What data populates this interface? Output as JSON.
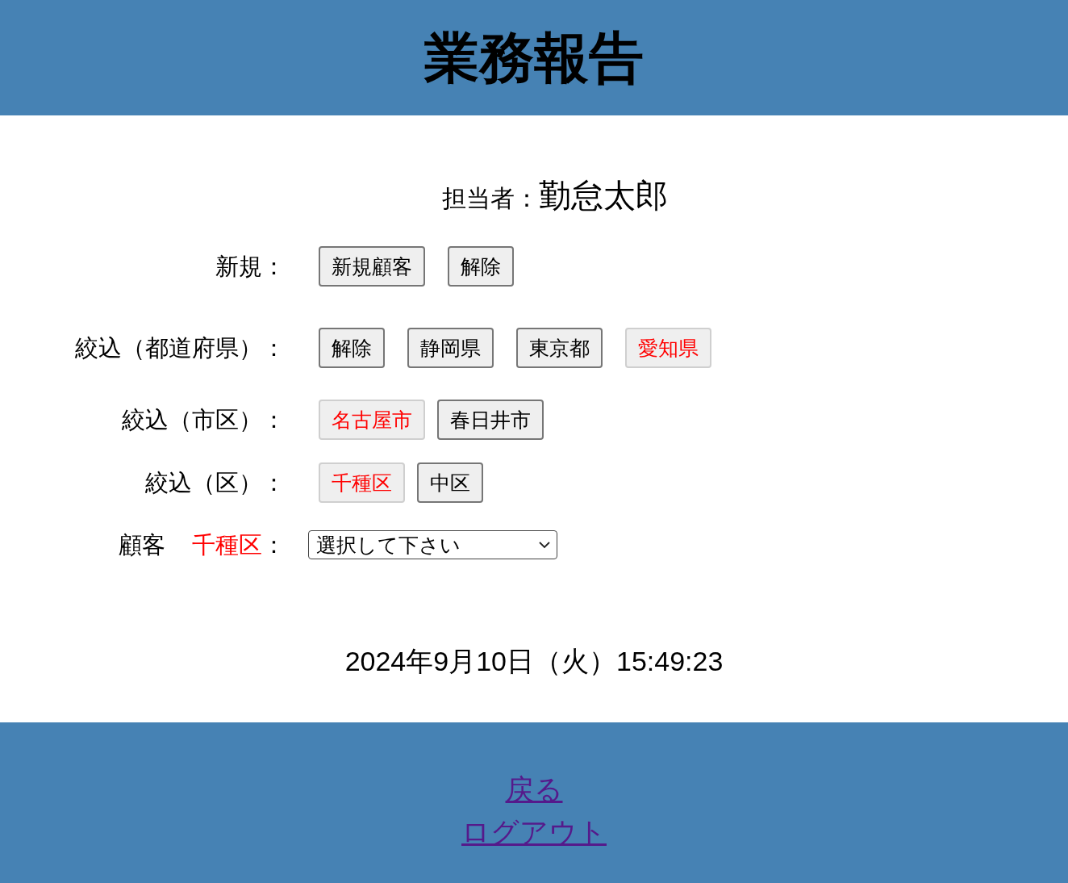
{
  "header": {
    "title": "業務報告"
  },
  "staff": {
    "label": "担当者：",
    "name": "勤怠太郎"
  },
  "filter_rows": [
    {
      "label": "新規：",
      "buttons": [
        {
          "label": "新規顧客",
          "selected": false
        },
        {
          "label": "解除",
          "selected": false
        }
      ]
    },
    {
      "label": "絞込（都道府県）：",
      "buttons": [
        {
          "label": "解除",
          "selected": false
        },
        {
          "label": "静岡県",
          "selected": false
        },
        {
          "label": "東京都",
          "selected": false
        },
        {
          "label": "愛知県",
          "selected": true
        }
      ]
    },
    {
      "label": "絞込（市区）：",
      "buttons": [
        {
          "label": "名古屋市",
          "selected": true
        },
        {
          "label": "春日井市",
          "selected": false
        }
      ]
    },
    {
      "label": "絞込（区）：",
      "buttons": [
        {
          "label": "千種区",
          "selected": true
        },
        {
          "label": "中区",
          "selected": false
        }
      ]
    }
  ],
  "customer": {
    "label": "顧客",
    "area": "千種区",
    "colon": "：",
    "select": {
      "value": "選択して下さい"
    }
  },
  "datetime": "2024年9月10日（火）15:49:23",
  "footer": {
    "links": [
      {
        "label": "戻る",
        "visited": true
      },
      {
        "label": "ログアウト",
        "visited": true
      }
    ]
  }
}
